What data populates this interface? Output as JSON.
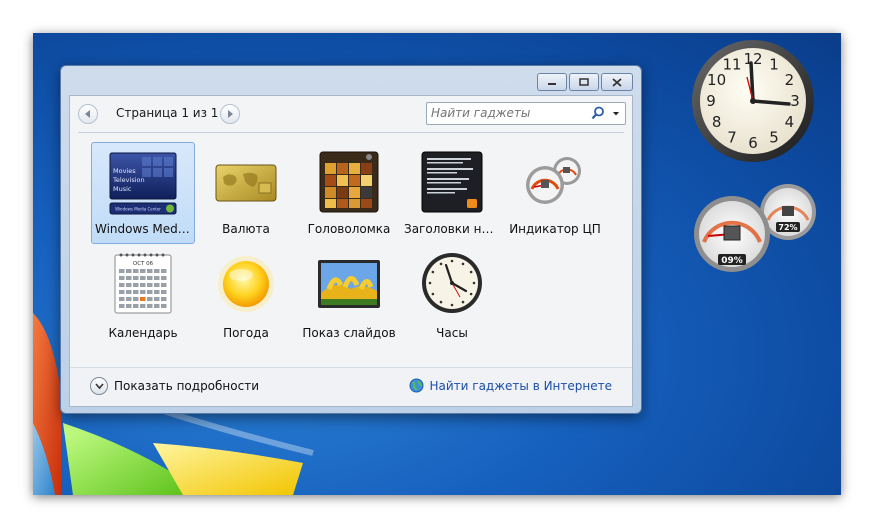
{
  "dialog": {
    "pager": {
      "text": "Страница 1 из 1"
    },
    "search": {
      "placeholder": "Найти гаджеты"
    },
    "gadgets": [
      {
        "label": "Windows Media…",
        "icon": "windows-media-center-thumb",
        "selected": true,
        "wmc_lines": [
          "Movies",
          "Television",
          "Music"
        ],
        "wmc_badge": "Windows Media Center"
      },
      {
        "label": "Валюта",
        "icon": "currency-map-thumb"
      },
      {
        "label": "Головоломка",
        "icon": "puzzle-thumb"
      },
      {
        "label": "Заголовки нов…",
        "icon": "news-feed-thumb"
      },
      {
        "label": "Индикатор ЦП",
        "icon": "cpu-meter-thumb"
      },
      {
        "label": "Календарь",
        "icon": "calendar-thumb",
        "month": "OCT 06"
      },
      {
        "label": "Погода",
        "icon": "sun-thumb"
      },
      {
        "label": "Показ слайдов",
        "icon": "slideshow-thumb"
      },
      {
        "label": "Часы",
        "icon": "clock-thumb"
      }
    ],
    "footer": {
      "details_label": "Показать подробности",
      "online_link": "Найти гаджеты в Интернете"
    }
  },
  "desktop": {
    "clock_numbers": [
      "12",
      "1",
      "2",
      "3",
      "4",
      "5",
      "6",
      "7",
      "8",
      "9",
      "10",
      "11"
    ],
    "cpu_meter": {
      "cpu_percent": "09%",
      "memory_percent": "72%"
    }
  },
  "colors": {
    "desktop_blue": "#1660bd",
    "selection": "#c1dcf7",
    "link": "#1a4fa8"
  }
}
